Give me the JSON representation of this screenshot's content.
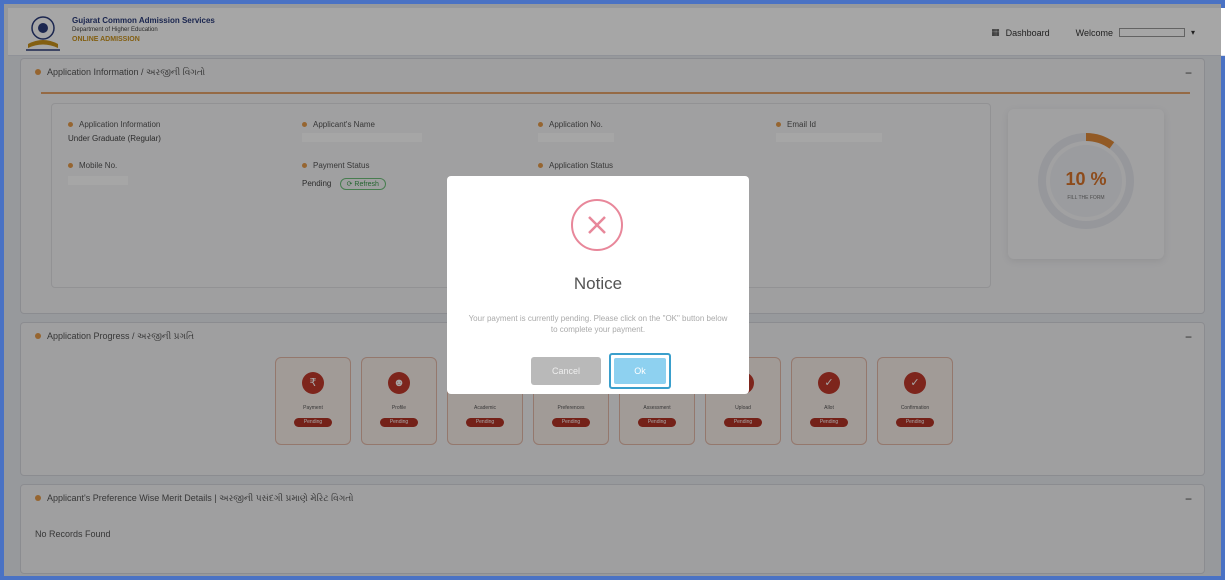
{
  "header": {
    "org_title": "Gujarat Common Admission Services",
    "org_sub": "Department of Higher Education",
    "org_tag": "ONLINE ADMISSION",
    "dashboard_label": "Dashboard",
    "welcome_label": "Welcome"
  },
  "app_info": {
    "section_title": "Application Information / અરજીની વિગતો",
    "fields": {
      "application_information_label": "Application Information",
      "application_information_value": "Under Graduate (Regular)",
      "applicant_name_label": "Applicant's Name",
      "application_no_label": "Application No.",
      "email_label": "Email Id",
      "mobile_label": "Mobile No.",
      "payment_status_label": "Payment Status",
      "payment_status_value": "Pending",
      "refresh_label": "Refresh",
      "application_status_label": "Application Status"
    },
    "progress": {
      "percent_text": "10 %",
      "caption": "FILL THE FORM",
      "value": 0.1
    }
  },
  "app_progress": {
    "section_title": "Application Progress / અરજીની પ્રગતિ",
    "steps": [
      {
        "label": "Payment",
        "status": "Pending",
        "icon": "rupee-icon"
      },
      {
        "label": "Profile",
        "status": "Pending",
        "icon": "user-icon"
      },
      {
        "label": "Academic",
        "status": "Pending",
        "icon": "check-icon"
      },
      {
        "label": "Preferences",
        "status": "Pending",
        "icon": "check-icon"
      },
      {
        "label": "Assessment",
        "status": "Pending",
        "icon": "check-icon"
      },
      {
        "label": "Upload",
        "status": "Pending",
        "icon": "check-icon"
      },
      {
        "label": "Allot",
        "status": "Pending",
        "icon": "check-icon"
      },
      {
        "label": "Confirmation",
        "status": "Pending",
        "icon": "check-icon"
      }
    ]
  },
  "preference": {
    "section_title": "Applicant's Preference Wise Merit Details | અરજીની પસંદગી પ્રમાણે મેરિટ વિગતો",
    "empty_text": "No Records Found"
  },
  "modal": {
    "title": "Notice",
    "message": "Your payment is currently pending. Please click on the \"OK\" button below to complete your payment.",
    "cancel_label": "Cancel",
    "ok_label": "Ok"
  },
  "colors": {
    "accent_orange": "#e69c4a",
    "step_red": "#c0392b",
    "modal_ok_blue": "#8ed1f0",
    "error_pink": "#e8879a",
    "frame_blue": "#4a72c4"
  }
}
